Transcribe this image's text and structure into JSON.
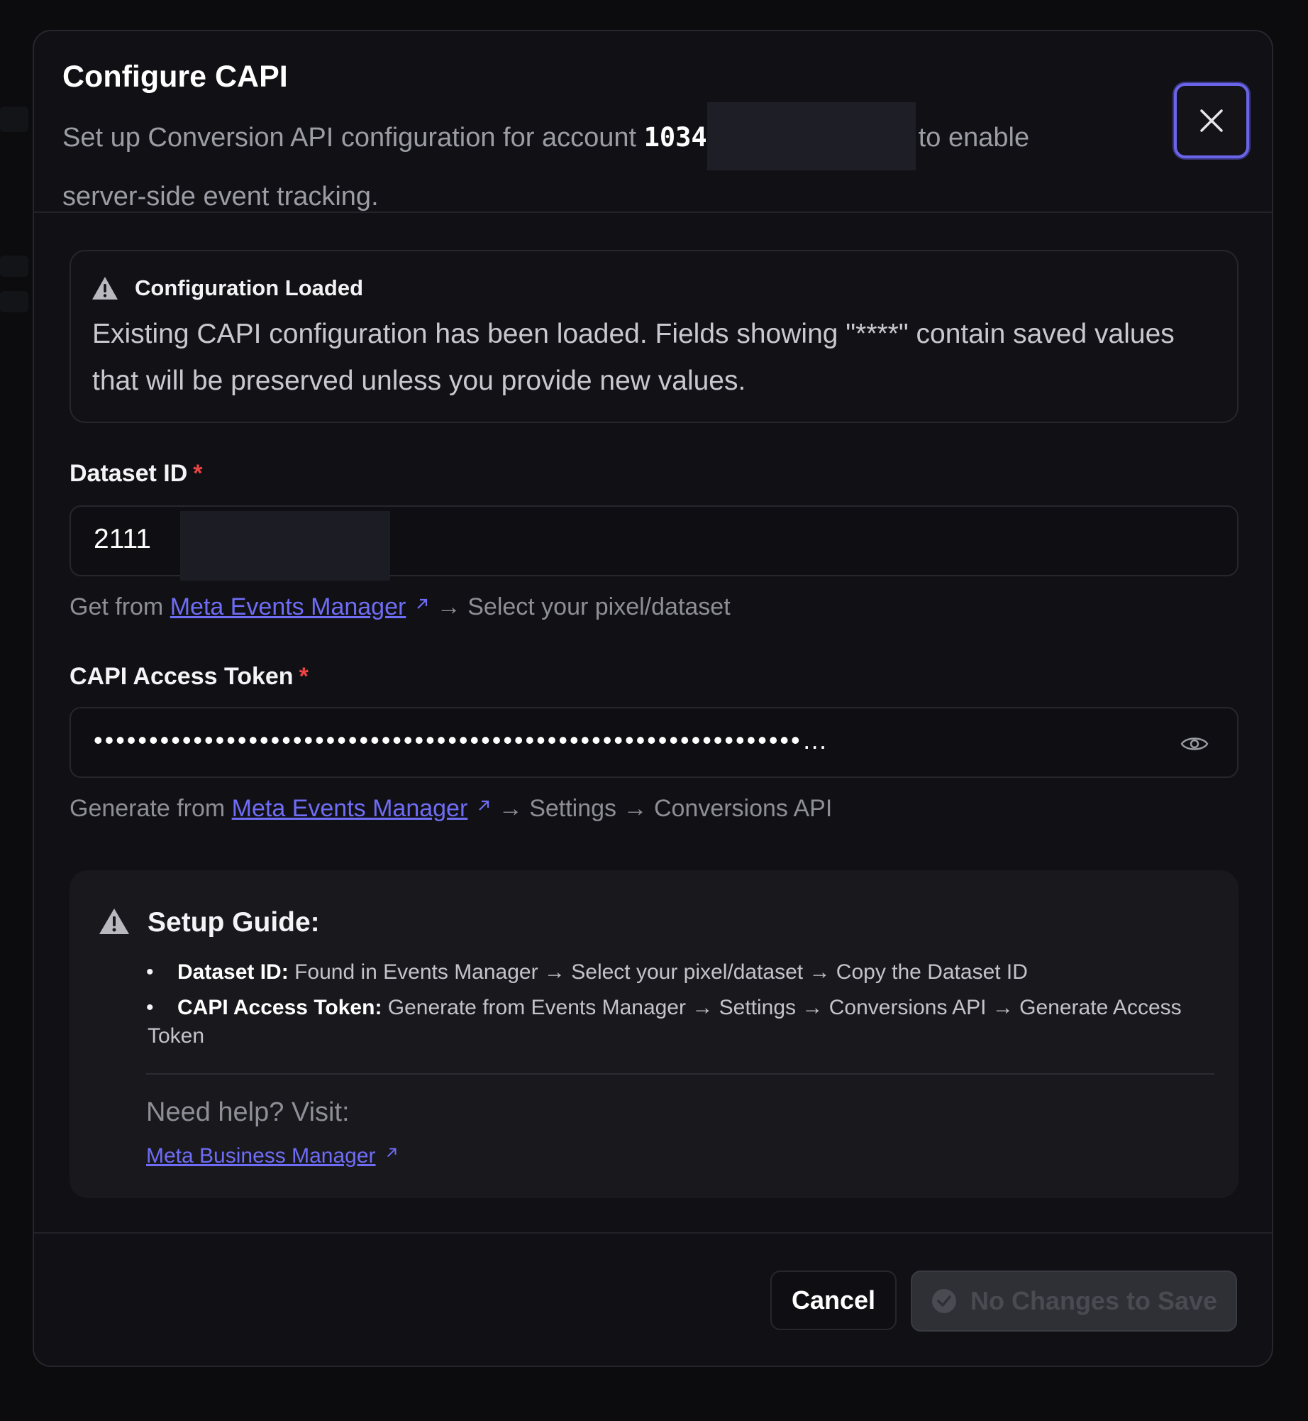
{
  "dialog": {
    "title": "Configure CAPI",
    "description_prefix": "Set up Conversion API configuration for account",
    "account_id": "1034",
    "description_suffix": "to enable server-side event tracking.",
    "close_label": "Close"
  },
  "alert": {
    "icon": "warning-icon",
    "title": "Configuration Loaded",
    "text": "Existing CAPI configuration has been loaded. Fields showing \"****\" contain saved values that will be preserved unless you provide new values."
  },
  "dataset": {
    "label": "Dataset ID",
    "required_mark": "*",
    "value": "2111",
    "hint_prefix": "Get from",
    "hint_link": "Meta Events Manager",
    "hint_suffix": "→ Select your pixel/dataset"
  },
  "token": {
    "label": "CAPI Access Token",
    "required_mark": "*",
    "masked_value": "••••••••••••••••••••••••••••••••••••••••••••••••••••••••••••••••…",
    "toggle_icon": "eye-icon",
    "hint_prefix": "Generate from",
    "hint_link": "Meta Events Manager",
    "hint_suffix": "→ Settings → Conversions API"
  },
  "guide": {
    "icon": "warning-icon",
    "title": "Setup Guide:",
    "items": [
      {
        "term": "Dataset ID:",
        "text": "Found in Events Manager → Select your pixel/dataset → Copy the Dataset ID"
      },
      {
        "term": "CAPI Access Token:",
        "text": "Generate from Events Manager → Settings → Conversions API → Generate Access Token"
      }
    ],
    "help_text": "Need help? Visit:",
    "help_link": "Meta Business Manager"
  },
  "footer": {
    "cancel_label": "Cancel",
    "save_label": "No Changes to Save"
  },
  "colors": {
    "accent": "#6f6cf5",
    "required": "#ef4444",
    "background": "#111115"
  }
}
